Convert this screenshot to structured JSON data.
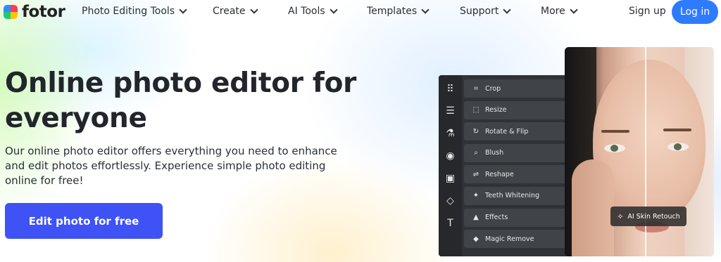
{
  "brand": {
    "name": "fotor"
  },
  "nav": {
    "items": [
      {
        "label": "Photo Editing Tools"
      },
      {
        "label": "Create"
      },
      {
        "label": "AI Tools"
      },
      {
        "label": "Templates"
      },
      {
        "label": "Support"
      },
      {
        "label": "More"
      }
    ],
    "signup": "Sign up",
    "login": "Log in"
  },
  "hero": {
    "title": "Online photo editor for everyone",
    "description": "Our online photo editor offers everything you need to enhance and edit photos effortlessly. Experience simple photo editing online for free!",
    "cta": "Edit photo for free"
  },
  "editor": {
    "tools": [
      {
        "label": "Crop",
        "icon": "crop-icon"
      },
      {
        "label": "Resize",
        "icon": "resize-icon"
      },
      {
        "label": "Rotate & Flip",
        "icon": "rotate-icon"
      },
      {
        "label": "Blush",
        "icon": "blush-icon"
      },
      {
        "label": "Reshape",
        "icon": "reshape-icon"
      },
      {
        "label": "Teeth Whitening",
        "icon": "teeth-icon"
      },
      {
        "label": "Effects",
        "icon": "effects-icon"
      },
      {
        "label": "Magic Remove",
        "icon": "eraser-icon"
      }
    ],
    "rail_icons": [
      "grid-icon",
      "sliders-icon",
      "flask-icon",
      "eye-icon",
      "frame-icon",
      "shapes-icon",
      "text-icon"
    ],
    "badge": "AI Skin Retouch"
  },
  "colors": {
    "cta": "#3e52f5",
    "login": "#2f7bff",
    "editor_bg": "#2f3236"
  }
}
